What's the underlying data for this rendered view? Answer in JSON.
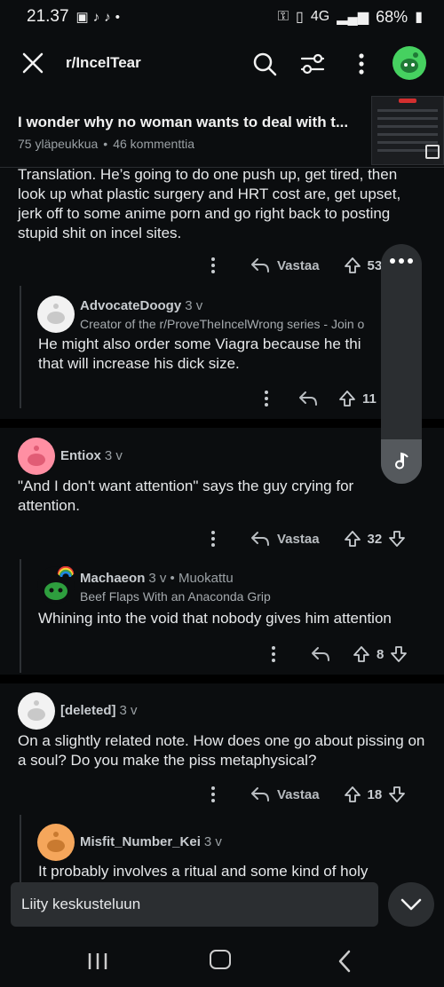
{
  "status": {
    "time": "21.37",
    "network": "4G",
    "battery": "68%"
  },
  "header": {
    "subreddit": "r/IncelTear"
  },
  "post": {
    "title": "I wonder why no woman wants to deal with t...",
    "upvotes": "75 yläpeukkua",
    "comments": "46 kommenttia"
  },
  "comments": [
    {
      "text": "Translation. He’s going to do one push up, get tired, then look up what plastic surgery and HRT cost are, get upset, jerk off to some anime porn and go right back to posting stupid shit on incel sites.",
      "reply_label": "Vastaa",
      "score": "53"
    },
    {
      "user": "AdvocateDoogy",
      "age": "3 v",
      "flair": "Creator of the r/ProveTheIncelWrong series - Join o",
      "text": "He might also order some Viagra because he thi that will increase his dick size.",
      "score": "11"
    },
    {
      "user": "Entiox",
      "age": "3 v",
      "text": "\"And I don't want attention\" says the guy crying for attention.",
      "reply_label": "Vastaa",
      "score": "32"
    },
    {
      "user": "Machaeon",
      "age": "3 v • Muokattu",
      "flair": "Beef Flaps With an Anaconda Grip",
      "text": "Whining into the void that nobody gives him attention",
      "score": "8"
    },
    {
      "user": "[deleted]",
      "age": "3 v",
      "text": "On a slightly related note. How does one go about pissing on a soul? Do you make the piss metaphysical?",
      "reply_label": "Vastaa",
      "score": "18"
    },
    {
      "user": "Misfit_Number_Kei",
      "age": "3 v",
      "text": "It probably involves a ritual and some kind of holy"
    }
  ],
  "footer": {
    "join_placeholder": "Liity keskusteluun"
  },
  "colors": {
    "background": "#0b0d0f",
    "accent_green": "#46d160",
    "avatar_pink": "#ff8fa3",
    "avatar_orange": "#f5a65b"
  }
}
